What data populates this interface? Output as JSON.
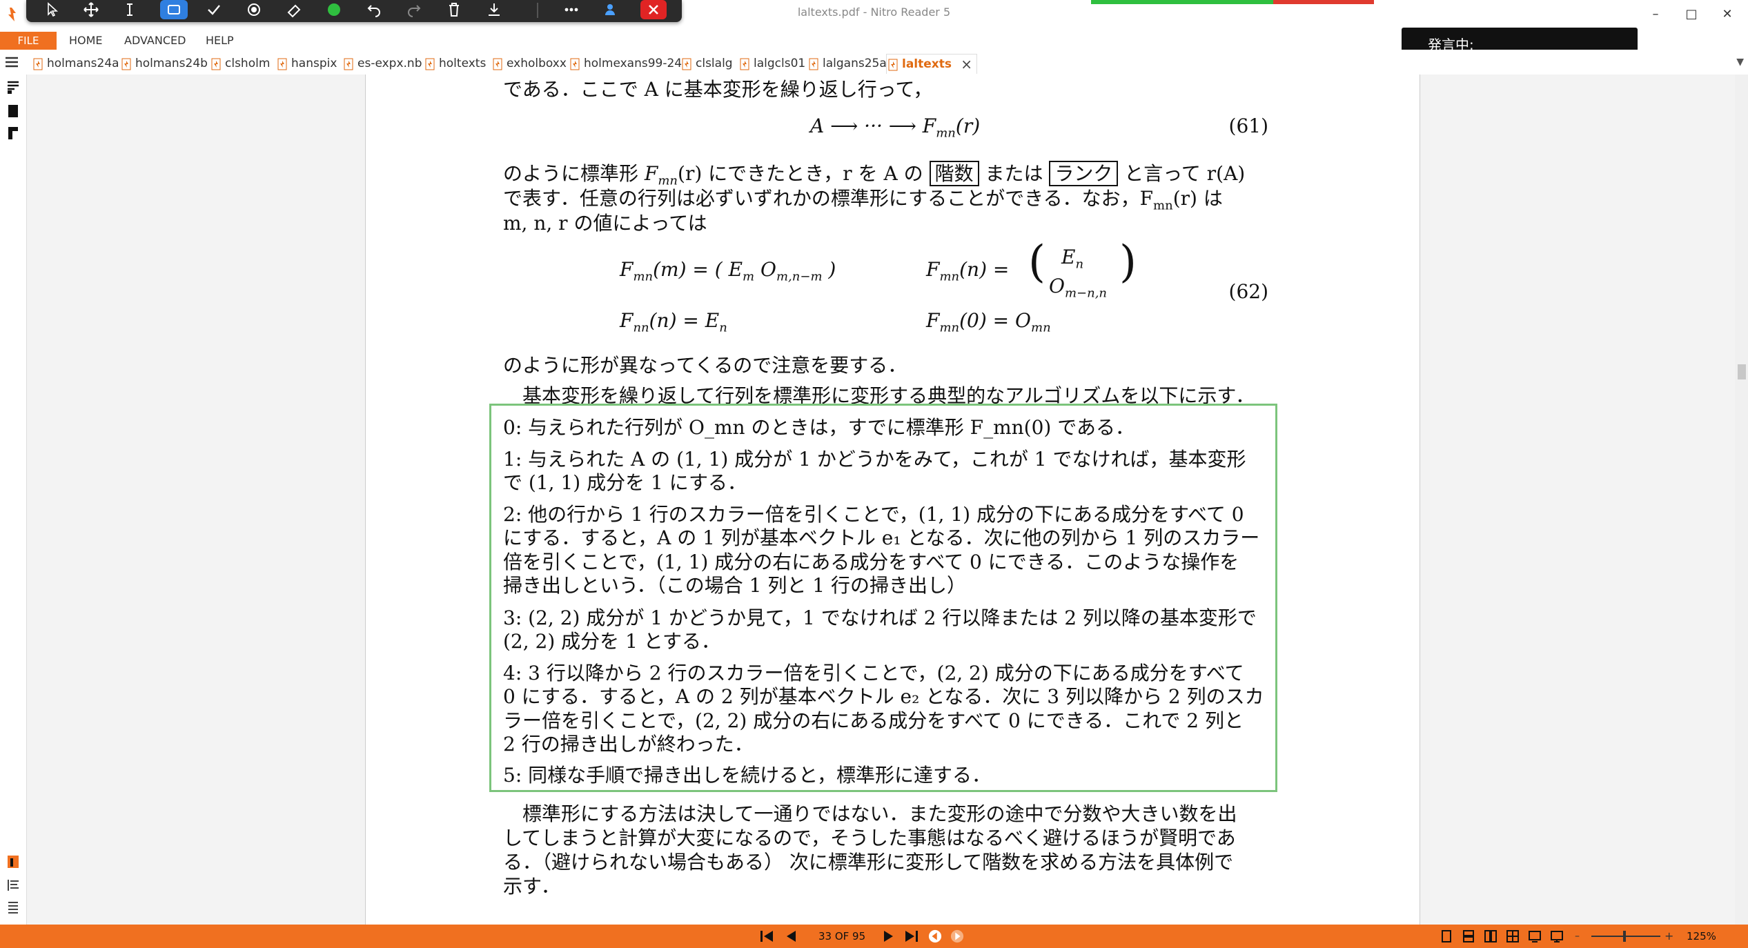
{
  "window": {
    "title": "laltexts.pdf - Nitro Reader 5",
    "minimize": "–",
    "maximize": "□",
    "close": "✕"
  },
  "menu": {
    "file": "FILE",
    "items": [
      "HOME",
      "ADVANCED",
      "HELP"
    ]
  },
  "speaking_indicator": "発言中:",
  "tabs": [
    "holmans24a",
    "holmans24b",
    "clsholm",
    "hanspix",
    "es-expx.nb",
    "holtexts",
    "exholboxx",
    "holmexans99-24",
    "clslalg",
    "lalgcls01",
    "lalgans25a"
  ],
  "active_tab": "laltexts",
  "document": {
    "l1": "である．ここで A に基本変形を繰り返し行って，",
    "eq61": "A ⟶ ··· ⟶ F",
    "eq61_sub": "mn",
    "eq61_tail": "(r)",
    "eq61_num": "(61)",
    "l2a": "のように標準形 ",
    "l2b": "F",
    "l2b_sub": "mn",
    "l2c": "(r) にできたとき，r を A の ",
    "l2_box1": "階数",
    "l2d": " または ",
    "l2_box2": "ランク",
    "l2e": " と言って r(A)",
    "l3": "で表す．任意の行列は必ずいずれかの標準形にすることができる．なお，F",
    "l3_sub": "mn",
    "l3_tail": "(r) は",
    "l4": "m, n, r の値によっては",
    "eq62a": "F",
    "eq62a_sub": "mn",
    "eq62a_rest": "(m) = ( E",
    "eq62a_sub2": "m",
    "eq62a_o": "   O",
    "eq62a_sub3": "m,n−m",
    "eq62a_close": " )",
    "eq62b": "F",
    "eq62b_sub": "mn",
    "eq62b_rest": "(n) =",
    "eq62b_top": "E",
    "eq62b_top_sub": "n",
    "eq62b_bot": "O",
    "eq62b_bot_sub": "m−n,n",
    "eq62c": "F",
    "eq62c_sub": "nn",
    "eq62c_rest": "(n) = E",
    "eq62c_sub2": "n",
    "eq62d": "F",
    "eq62d_sub": "mn",
    "eq62d_rest": "(0) = O",
    "eq62d_sub2": "mn",
    "eq62_num": "(62)",
    "l5": "のように形が異なってくるので注意を要する．",
    "l6": "　基本変形を繰り返して行列を標準形に変形する典型的なアルゴリズムを以下に示す．",
    "alg": [
      "0:  与えられた行列が O_mn のときは，すでに標準形 F_mn(0) である．",
      "1:  与えられた A の (1, 1) 成分が 1 かどうかをみて，これが 1 でなければ，基本変形",
      "で (1, 1) 成分を 1 にする．",
      "2:  他の行から 1 行のスカラー倍を引くことで，(1, 1) 成分の下にある成分をすべて 0",
      "にする．すると，A の 1 列が基本ベクトル e₁ となる．次に他の列から 1 列のスカラー",
      "倍を引くことで，(1, 1) 成分の右にある成分をすべて 0 にできる．このような操作を",
      "掃き出しという．（この場合 1 列と 1 行の掃き出し）",
      "3:  (2, 2) 成分が 1 かどうか見て，1 でなければ 2 行以降または 2 列以降の基本変形で",
      "(2, 2) 成分を 1 とする．",
      "4:  3 行以降から 2 行のスカラー倍を引くことで，(2, 2) 成分の下にある成分をすべて",
      "0 にする．すると，A の 2 列が基本ベクトル e₂ となる．次に 3 列以降から 2 列のスカ",
      "ラー倍を引くことで，(2, 2) 成分の右にある成分をすべて 0 にできる．これで 2 列と",
      "2 行の掃き出しが終わった．",
      "5:  同様な手順で掃き出しを続けると，標準形に達する．"
    ],
    "p2": [
      "　標準形にする方法は決して一通りではない．また変形の途中で分数や大きい数を出",
      "してしまうと計算が大変になるので，そうした事態はなるべく避けるほうが賢明であ",
      "る．（避けられない場合もある） 次に標準形に変形して階数を求める方法を具体例で",
      "示す．"
    ]
  },
  "status": {
    "page": "33 OF 95",
    "zoom": "125%"
  },
  "colors": {
    "accent": "#f07020",
    "selection": "#2f7fe0",
    "box": "#7cc47c"
  }
}
